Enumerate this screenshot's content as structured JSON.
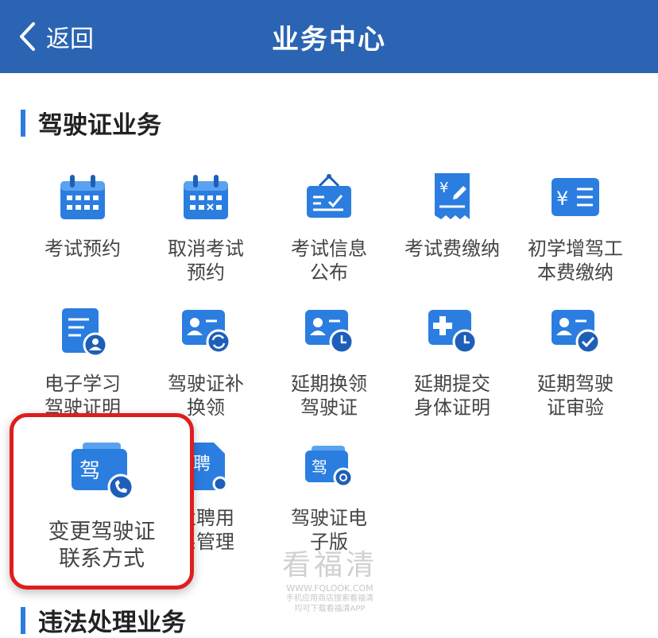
{
  "header": {
    "back_label": "返回",
    "title": "业务中心"
  },
  "sections": {
    "license": "驾驶证业务",
    "violation": "违法处理业务"
  },
  "items": [
    {
      "line1": "考试预约",
      "line2": ""
    },
    {
      "line1": "取消考试",
      "line2": "预约"
    },
    {
      "line1": "考试信息",
      "line2": "公布"
    },
    {
      "line1": "考试费缴纳",
      "line2": ""
    },
    {
      "line1": "初学增驾工",
      "line2": "本费缴纳"
    },
    {
      "line1": "电子学习",
      "line2": "驾驶证明"
    },
    {
      "line1": "驾驶证补",
      "line2": "换领"
    },
    {
      "line1": "延期换领",
      "line2": "驾驶证"
    },
    {
      "line1": "延期提交",
      "line2": "身体证明"
    },
    {
      "line1": "延期驾驶",
      "line2": "证审验"
    },
    {
      "line1": "变更驾驶证",
      "line2": "联系方式"
    },
    {
      "line1": "业聘用",
      "line2": "系管理"
    },
    {
      "line1": "驾驶证电",
      "line2": "子版"
    }
  ],
  "icon_glyphs": {
    "jia": "驾",
    "pin": "聘",
    "yen": "¥"
  },
  "icons": [
    "calendar-icon",
    "calendar-cancel-icon",
    "notice-board-icon",
    "fee-receipt-icon",
    "yen-card-icon",
    "e-learning-doc-icon",
    "license-renew-icon",
    "license-delay-icon",
    "medical-delay-icon",
    "license-verify-icon",
    "license-phone-icon",
    "employment-icon",
    "e-license-icon"
  ],
  "watermark": {
    "brand": "看福清",
    "url": "WWW.FQLOOK.COM",
    "line1": "手机应用商店搜索看福清",
    "line2": "均可下载看福清APP"
  },
  "colors": {
    "header": "#2b64b3",
    "accent": "#2b7de0",
    "highlight_border": "#e01d1d"
  }
}
